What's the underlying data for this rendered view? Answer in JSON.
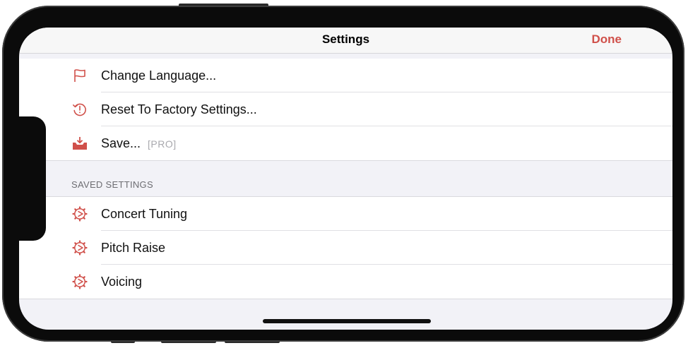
{
  "nav": {
    "title": "Settings",
    "done_label": "Done"
  },
  "top_items": [
    {
      "icon": "flag-icon",
      "label": "Change Language..."
    },
    {
      "icon": "reset-icon",
      "label": "Reset To Factory Settings..."
    },
    {
      "icon": "save-tray-icon",
      "label": "Save...",
      "badge": "[PRO]"
    }
  ],
  "saved_section": {
    "header": "SAVED SETTINGS",
    "items": [
      {
        "icon": "gear-play-icon",
        "label": "Concert Tuning"
      },
      {
        "icon": "gear-play-icon",
        "label": "Pitch Raise"
      },
      {
        "icon": "gear-play-icon",
        "label": "Voicing"
      }
    ]
  },
  "colors": {
    "accent": "#d0504a",
    "background": "#f2f2f7"
  }
}
